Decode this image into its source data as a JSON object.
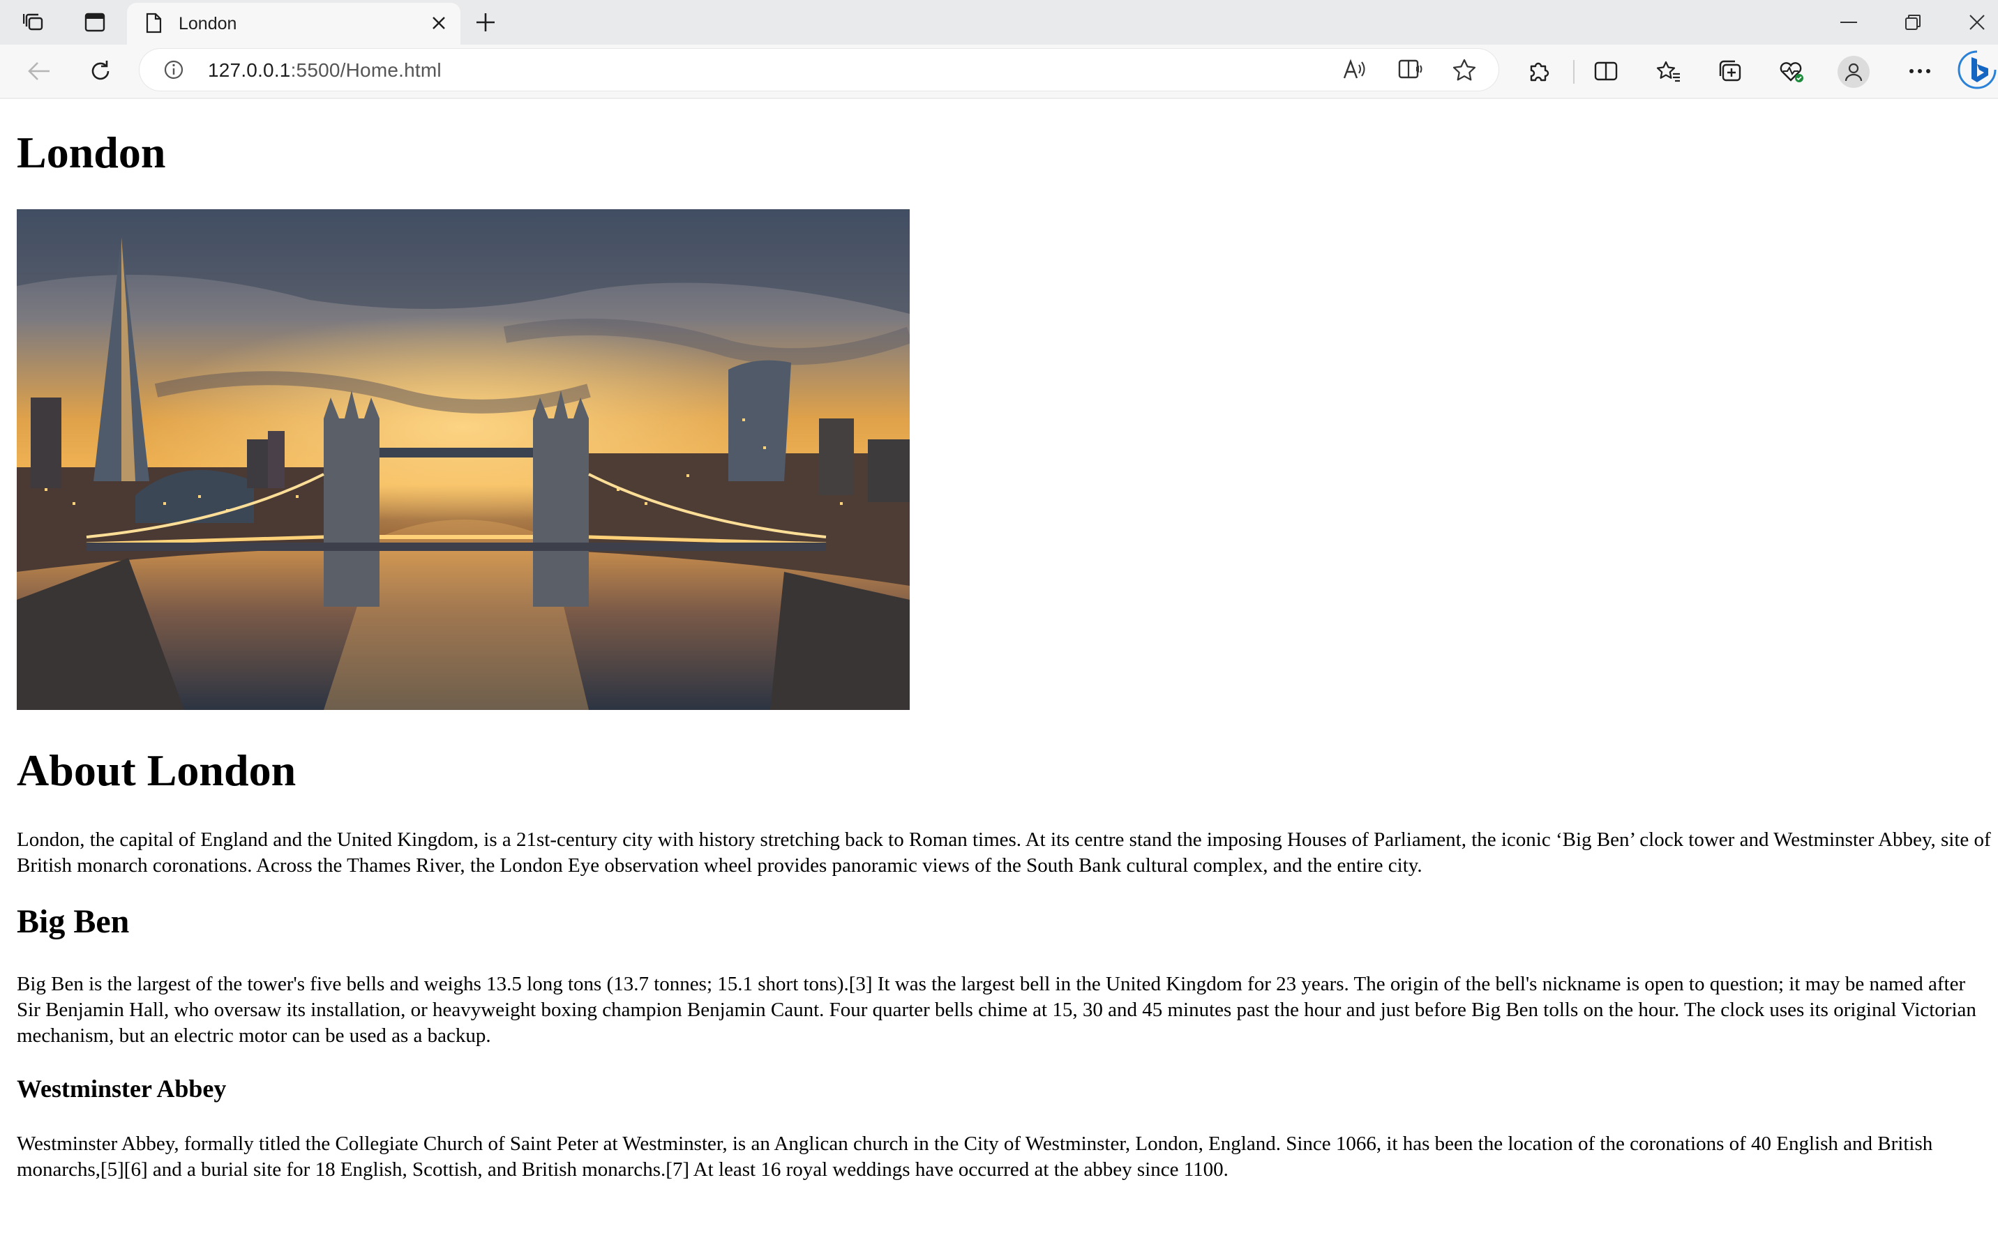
{
  "browser": {
    "tab_title": "London",
    "url_host": "127.0.0.1",
    "url_rest": ":5500/Home.html"
  },
  "page": {
    "title": "London",
    "hero_image_icon": "tower-bridge-sunset-photo",
    "about_heading": "About London",
    "about_text": "London, the capital of England and the United Kingdom, is a 21st-century city with history stretching back to Roman times. At its centre stand the imposing Houses of Parliament, the iconic ‘Big Ben’ clock tower and Westminster Abbey, site of British monarch coronations. Across the Thames River, the London Eye observation wheel provides panoramic views of the South Bank cultural complex, and the entire city.",
    "bigben_heading": "Big Ben",
    "bigben_text": "Big Ben is the largest of the tower's five bells and weighs 13.5 long tons (13.7 tonnes; 15.1 short tons).[3] It was the largest bell in the United Kingdom for 23 years. The origin of the bell's nickname is open to question; it may be named after Sir Benjamin Hall, who oversaw its installation, or heavyweight boxing champion Benjamin Caunt. Four quarter bells chime at 15, 30 and 45 minutes past the hour and just before Big Ben tolls on the hour. The clock uses its original Victorian mechanism, but an electric motor can be used as a backup.",
    "abbey_heading": "Westminster Abbey",
    "abbey_text": "Westminster Abbey, formally titled the Collegiate Church of Saint Peter at Westminster, is an Anglican church in the City of Westminster, London, England. Since 1066, it has been the location of the coronations of 40 English and British monarchs,[5][6] and a burial site for 18 English, Scottish, and British monarchs.[7] At least 16 royal weddings have occurred at the abbey since 1100."
  }
}
